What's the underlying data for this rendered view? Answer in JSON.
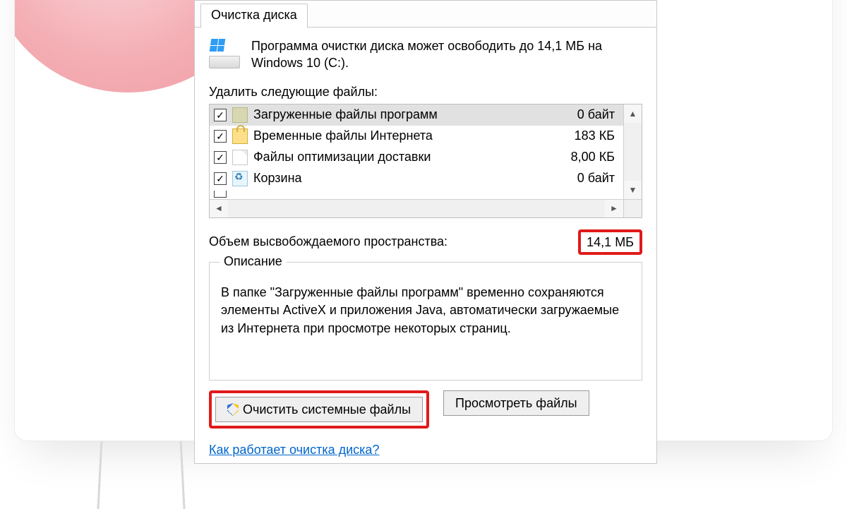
{
  "tab_label": "Очистка диска",
  "summary": "Программа очистки диска может освободить до 14,1 МБ на Windows 10 (C:).",
  "delete_label": "Удалить следующие файлы:",
  "files": [
    {
      "checked": true,
      "icon": "folder",
      "label": "Загруженные файлы программ",
      "size": "0 байт",
      "selected": true
    },
    {
      "checked": true,
      "icon": "lock",
      "label": "Временные файлы Интернета",
      "size": "183 КБ",
      "selected": false
    },
    {
      "checked": true,
      "icon": "page",
      "label": "Файлы оптимизации доставки",
      "size": "8,00 КБ",
      "selected": false
    },
    {
      "checked": true,
      "icon": "recycle",
      "label": "Корзина",
      "size": "0 байт",
      "selected": false
    }
  ],
  "freespace_label": "Объем высвобождаемого пространства:",
  "freespace_value": "14,1 МБ",
  "group_title": "Описание",
  "description": "В папке \"Загруженные файлы программ\" временно сохраняются элементы ActiveX и приложения Java, автоматически загружаемые из Интернета при просмотре некоторых страниц.",
  "btn_clean_system": "Очистить системные файлы",
  "btn_view_files": "Просмотреть файлы",
  "help_link": "Как работает очистка диска?",
  "colors": {
    "highlight": "#e11a1a",
    "link": "#0066cc"
  }
}
